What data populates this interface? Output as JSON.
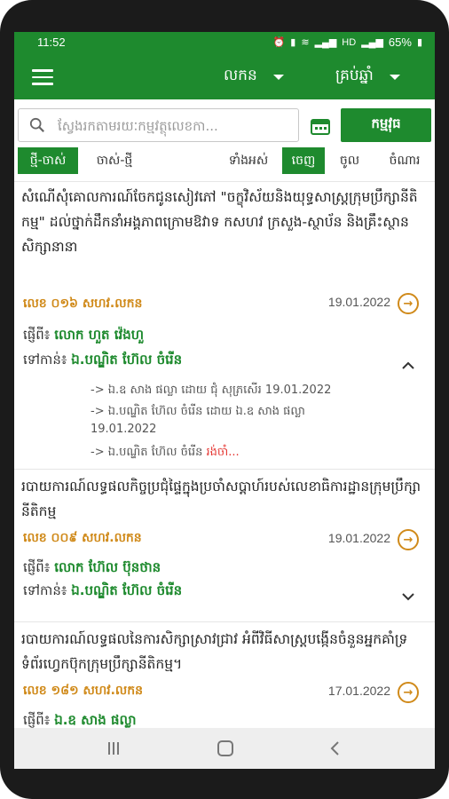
{
  "status": {
    "time": "11:52",
    "battery": "65%",
    "net": "HD"
  },
  "appbar": {
    "dropdown1": "លកន",
    "dropdown2": "គ្រប់ឆ្នាំ"
  },
  "search": {
    "placeholder": "ស្វែងរកតាមរយៈកម្មវត្ថុលេខកា...",
    "button": "កម្មវុធ"
  },
  "filters": {
    "new_old": "ថ្មី-ចាស់",
    "old_new": "ចាស់-ថ្មី",
    "all": "ទាំងអស់",
    "out": "ចេញ",
    "in": "ចូល",
    "cc": "ចំណារ"
  },
  "items": [
    {
      "subject": "សំណើសុំគោលការណ៍ចែកជូនសៀវភៅ \"ចក្ខុវិស័យនិងយុទ្ធសាស្ត្រក្រុមប្រឹក្សានីតិកម្ម\" ដល់ថ្នាក់ដឹកនាំអង្គភាពក្រោមឱវាទ កសហវ ក្រសួង-ស្ថាប័ន និងគ្រឹះស្ថានសិក្សានានា",
      "number": "លេខ ០១៦ សហវ.លកន",
      "date": "19.01.2022",
      "from_label": "ផ្ញើពី៖",
      "from": "លោក ហួត វ៉េងហួ",
      "to_label": "ទៅកាន់៖",
      "to": "ឯ.បណ្ឌិត ហ៊ែល ចំរើន",
      "trail": [
        "-> ឯ.ឧ សាង ផល្លា ដោយ ជុំ សុភ្រសើរ 19.01.2022",
        "-> ឯ.បណ្ឌិត ហ៊ែល ចំរើន ដោយ ឯ.ឧ សាង ផល្លា",
        "19.01.2022",
        "-> ឯ.បណ្ឌិត ហ៊ែល ចំរើន",
        "រង់ចាំ..."
      ]
    },
    {
      "subject": "របាយការណ៍លទ្ធផលកិច្ចប្រជុំផ្ទៃក្នុងប្រចាំសប្ដាហ៍របស់លេខាធិការដ្ឋានក្រុមប្រឹក្សានីតិកម្ម",
      "number": "លេខ ០០៩ សហវ.លកន",
      "date": "19.01.2022",
      "from_label": "ផ្ញើពី៖",
      "from": "លោក ហ៊ែល ប៊ុនថាន",
      "to_label": "ទៅកាន់៖",
      "to": "ឯ.បណ្ឌិត ហ៊ែល ចំរើន"
    },
    {
      "subject": "របាយការណ៍លទ្ធផលនៃការសិក្សាស្រាវជ្រាវ អំពីវិធីសាស្ត្របង្កើនចំនួនអ្នកគាំទ្រទំព័រហ្វេកប៊ុកក្រុមប្រឹក្សានីតិកម្ម។",
      "number": "លេខ ១៨១ សហវ.លកន",
      "date": "17.01.2022",
      "from_label": "ផ្ញើពី៖",
      "from": "ឯ.ឧ សាង ផល្លា"
    }
  ],
  "colors": {
    "brand": "#1e8a2e",
    "accent": "#d08a1a",
    "pending": "#e53935"
  }
}
